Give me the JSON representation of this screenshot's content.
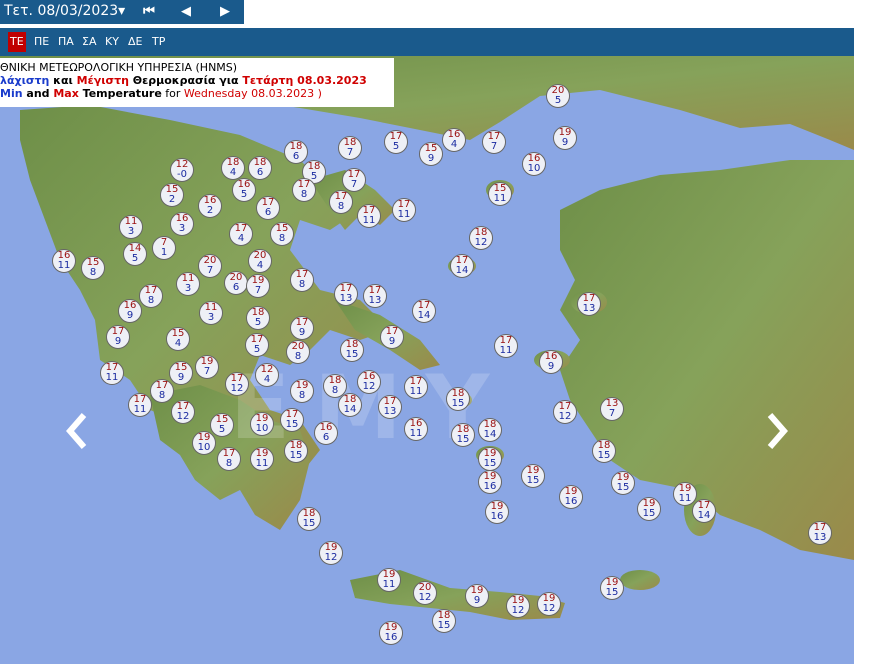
{
  "header": {
    "date_label": "Τετ. 08/03/2023▾",
    "first_icon": "skip-first-icon",
    "prev_icon": "previous-icon",
    "next_icon": "next-icon"
  },
  "days": [
    {
      "label": "ΤΕ",
      "active": true
    },
    {
      "label": "ΠΕ",
      "active": false
    },
    {
      "label": "ΠΑ",
      "active": false
    },
    {
      "label": "ΣΑ",
      "active": false
    },
    {
      "label": "ΚΥ",
      "active": false
    },
    {
      "label": "ΔΕ",
      "active": false
    },
    {
      "label": "ΤΡ",
      "active": false
    }
  ],
  "legend": {
    "agency": "ΘΝΙΚΗ ΜΕΤΕΩΡΟΛΟΓΙΚΗ ΥΠΗΡΕΣΙΑ (HNMS)",
    "gr_min": "λάχιστη",
    "gr_and": " και ",
    "gr_max": "Μέγιστη",
    "gr_rest": " Θερμοκρασία για ",
    "gr_date": "Τετάρτη 08.03.2023",
    "en_min": "Min",
    "en_and": " and ",
    "en_max": "Max",
    "en_temp": " Temperature",
    "en_for": " for ",
    "en_date": "Wednesday 08.03.2023 )"
  },
  "watermark": "ΕΜΥ",
  "colors": {
    "sea": "#8aa6e4",
    "land": "#7a9a55",
    "bar": "#1a5a8c",
    "active_day": "#c00000",
    "max_text": "#9a1010",
    "min_text": "#1a2aa0"
  },
  "stations": [
    {
      "max": "20",
      "min": "5"
    },
    {
      "max": "19",
      "min": "9"
    },
    {
      "max": "16",
      "min": "10"
    },
    {
      "max": "17",
      "min": "5"
    },
    {
      "max": "16",
      "min": "4"
    },
    {
      "max": "17",
      "min": "7"
    },
    {
      "max": "15",
      "min": "9"
    },
    {
      "max": "18",
      "min": "7"
    },
    {
      "max": "18",
      "min": "6"
    },
    {
      "max": "18",
      "min": "4"
    },
    {
      "max": "18",
      "min": "6"
    },
    {
      "max": "12",
      "min": "-0"
    },
    {
      "max": "16",
      "min": "5"
    },
    {
      "max": "18",
      "min": "5"
    },
    {
      "max": "15",
      "min": "2"
    },
    {
      "max": "17",
      "min": "8"
    },
    {
      "max": "17",
      "min": "7"
    },
    {
      "max": "17",
      "min": "8"
    },
    {
      "max": "16",
      "min": "2"
    },
    {
      "max": "17",
      "min": "6"
    },
    {
      "max": "15",
      "min": "11"
    },
    {
      "max": "17",
      "min": "11"
    },
    {
      "max": "17",
      "min": "11"
    },
    {
      "max": "11",
      "min": "3"
    },
    {
      "max": "16",
      "min": "3"
    },
    {
      "max": "17",
      "min": "4"
    },
    {
      "max": "15",
      "min": "8"
    },
    {
      "max": "18",
      "min": "12"
    },
    {
      "max": "16",
      "min": "11"
    },
    {
      "max": "15",
      "min": "8"
    },
    {
      "max": "14",
      "min": "5"
    },
    {
      "max": "7",
      "min": "1"
    },
    {
      "max": "20",
      "min": "7"
    },
    {
      "max": "20",
      "min": "4"
    },
    {
      "max": "17",
      "min": "14"
    },
    {
      "max": "11",
      "min": "3"
    },
    {
      "max": "20",
      "min": "6"
    },
    {
      "max": "19",
      "min": "7"
    },
    {
      "max": "17",
      "min": "8"
    },
    {
      "max": "17",
      "min": "13"
    },
    {
      "max": "17",
      "min": "13"
    },
    {
      "max": "17",
      "min": "8"
    },
    {
      "max": "16",
      "min": "9"
    },
    {
      "max": "17",
      "min": "13"
    },
    {
      "max": "11",
      "min": "3"
    },
    {
      "max": "18",
      "min": "5"
    },
    {
      "max": "17",
      "min": "14"
    },
    {
      "max": "17",
      "min": "9"
    },
    {
      "max": "17",
      "min": "9"
    },
    {
      "max": "17",
      "min": "9"
    },
    {
      "max": "15",
      "min": "4"
    },
    {
      "max": "17",
      "min": "5"
    },
    {
      "max": "20",
      "min": "8"
    },
    {
      "max": "18",
      "min": "15"
    },
    {
      "max": "17",
      "min": "11"
    },
    {
      "max": "16",
      "min": "9"
    },
    {
      "max": "17",
      "min": "11"
    },
    {
      "max": "15",
      "min": "9"
    },
    {
      "max": "19",
      "min": "7"
    },
    {
      "max": "12",
      "min": "4"
    },
    {
      "max": "17",
      "min": "12"
    },
    {
      "max": "17",
      "min": "8"
    },
    {
      "max": "19",
      "min": "8"
    },
    {
      "max": "18",
      "min": "8"
    },
    {
      "max": "16",
      "min": "12"
    },
    {
      "max": "17",
      "min": "11"
    },
    {
      "max": "17",
      "min": "11"
    },
    {
      "max": "17",
      "min": "12"
    },
    {
      "max": "18",
      "min": "14"
    },
    {
      "max": "17",
      "min": "13"
    },
    {
      "max": "18",
      "min": "15"
    },
    {
      "max": "17",
      "min": "12"
    },
    {
      "max": "13",
      "min": "7"
    },
    {
      "max": "15",
      "min": "5"
    },
    {
      "max": "19",
      "min": "10"
    },
    {
      "max": "17",
      "min": "15"
    },
    {
      "max": "16",
      "min": "11"
    },
    {
      "max": "19",
      "min": "10"
    },
    {
      "max": "16",
      "min": "6"
    },
    {
      "max": "17",
      "min": "8"
    },
    {
      "max": "19",
      "min": "11"
    },
    {
      "max": "18",
      "min": "15"
    },
    {
      "max": "18",
      "min": "15"
    },
    {
      "max": "18",
      "min": "14"
    },
    {
      "max": "19",
      "min": "15"
    },
    {
      "max": "19",
      "min": "15"
    },
    {
      "max": "19",
      "min": "16"
    },
    {
      "max": "19",
      "min": "16"
    },
    {
      "max": "18",
      "min": "15"
    },
    {
      "max": "19",
      "min": "15"
    },
    {
      "max": "19",
      "min": "16"
    },
    {
      "max": "19",
      "min": "15"
    },
    {
      "max": "19",
      "min": "11"
    },
    {
      "max": "17",
      "min": "14"
    },
    {
      "max": "17",
      "min": "13"
    },
    {
      "max": "18",
      "min": "15"
    },
    {
      "max": "19",
      "min": "12"
    },
    {
      "max": "19",
      "min": "11"
    },
    {
      "max": "20",
      "min": "12"
    },
    {
      "max": "19",
      "min": "9"
    },
    {
      "max": "19",
      "min": "12"
    },
    {
      "max": "19",
      "min": "12"
    },
    {
      "max": "18",
      "min": "15"
    },
    {
      "max": "19",
      "min": "16"
    },
    {
      "max": "19",
      "min": "15"
    }
  ]
}
